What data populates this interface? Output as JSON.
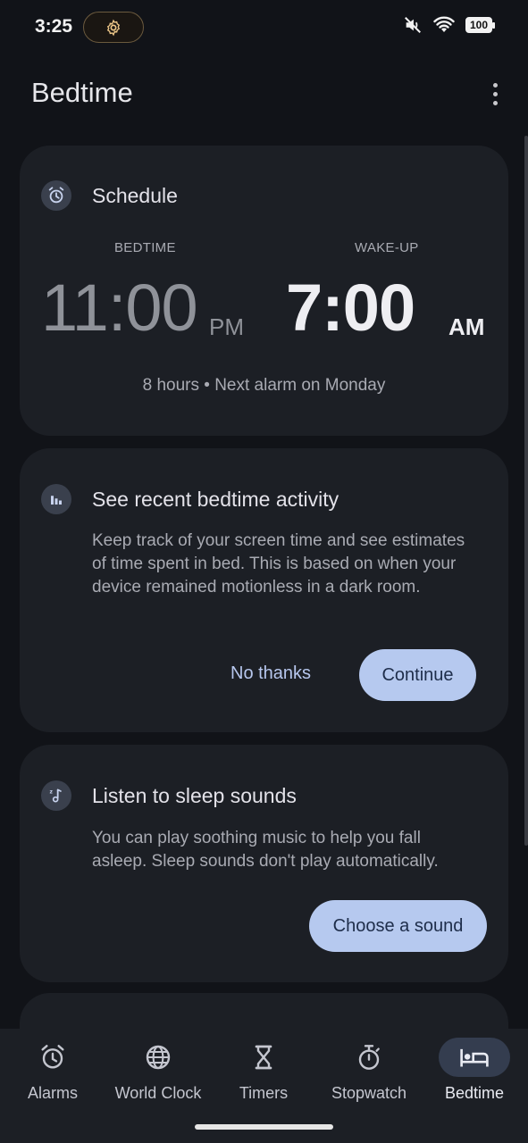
{
  "status_bar": {
    "time": "3:25",
    "battery": "100",
    "icons": [
      "settings-icon",
      "mute-icon",
      "wifi-icon",
      "battery-icon"
    ]
  },
  "app_bar": {
    "title": "Bedtime",
    "menu_icon": "more-vert-icon"
  },
  "schedule": {
    "title": "Schedule",
    "icon": "alarm-icon",
    "bedtime_label": "BEDTIME",
    "bedtime_time": "11:00",
    "bedtime_ampm": "PM",
    "wakeup_label": "WAKE-UP",
    "wakeup_time": "7:00",
    "wakeup_ampm": "AM",
    "summary": "8 hours • Next alarm on Monday"
  },
  "activity": {
    "title": "See recent bedtime activity",
    "icon": "bar-chart-icon",
    "body": "Keep track of your screen time and see estimates of time spent in bed. This is based on when your device remained motionless in a dark room.",
    "no_thanks": "No thanks",
    "continue": "Continue"
  },
  "sounds": {
    "title": "Listen to sleep sounds",
    "icon": "music-note-icon",
    "body": "You can play soothing music to help you fall asleep. Sleep sounds don't play automatically.",
    "choose": "Choose a sound"
  },
  "nav": {
    "items": [
      {
        "label": "Alarms",
        "icon": "alarm-icon"
      },
      {
        "label": "World Clock",
        "icon": "globe-icon"
      },
      {
        "label": "Timers",
        "icon": "hourglass-icon"
      },
      {
        "label": "Stopwatch",
        "icon": "stopwatch-icon"
      },
      {
        "label": "Bedtime",
        "icon": "bed-icon",
        "active": true
      }
    ]
  },
  "colors": {
    "background": "#111318",
    "card": "#1c1f25",
    "accent": "#b6c9ef"
  }
}
